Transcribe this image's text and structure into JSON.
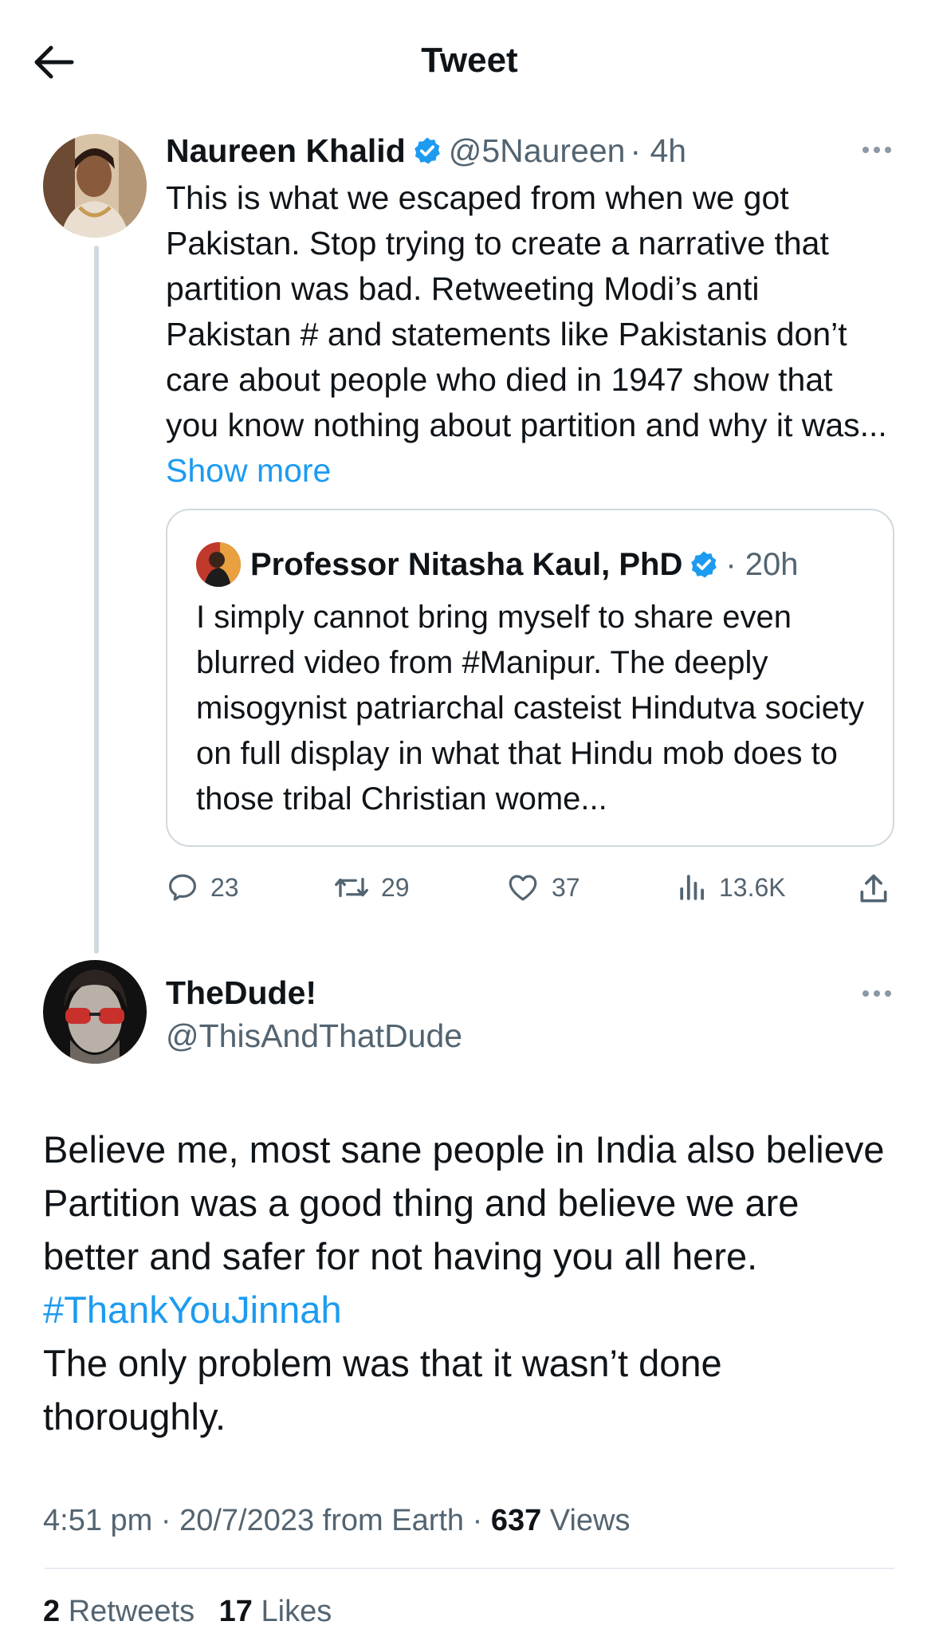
{
  "header": {
    "title": "Tweet",
    "back_icon": "arrow-left-icon"
  },
  "original_tweet": {
    "author_name": "Naureen Khalid",
    "handle": "@5Naureen",
    "time": "· 4h",
    "text": "This is what we escaped from when we got Pakistan. Stop trying to create a narrative that partition was bad.  Retweeting Modi’s anti Pakistan # and statements like Pakistanis don’t care about people who died in 1947 show that you know nothing about partition and why it was...",
    "show_more": "Show more",
    "quote": {
      "author_name": "Professor Nitasha Kaul, PhD",
      "time": "· 20h",
      "text": "I simply cannot bring myself to share even blurred video from #Manipur. The deeply misogynist patriarchal casteist Hindutva society on full display in what that Hindu mob does to those tribal Christian wome..."
    },
    "actions": {
      "replies": "23",
      "retweets": "29",
      "likes": "37",
      "views": "13.6K"
    }
  },
  "reply_tweet": {
    "author_name": "TheDude!",
    "handle": "@ThisAndThatDude",
    "text_before": "Believe me, most sane people in India also believe Partition was a good thing and believe we are better and safer for not having you all here. ",
    "hashtag": "#ThankYouJinnah",
    "text_after": "The only problem was that it wasn’t done thoroughly.",
    "timestamp": "4:51 pm · 20/7/2023 from Earth · ",
    "views_count": "637",
    "views_label": " Views",
    "retweets_count": "2",
    "retweets_label": " Retweets",
    "likes_count": "17",
    "likes_label": " Likes"
  },
  "colors": {
    "accent": "#1d9bf0",
    "secondary_text": "#536471",
    "border": "#cfd9de"
  }
}
